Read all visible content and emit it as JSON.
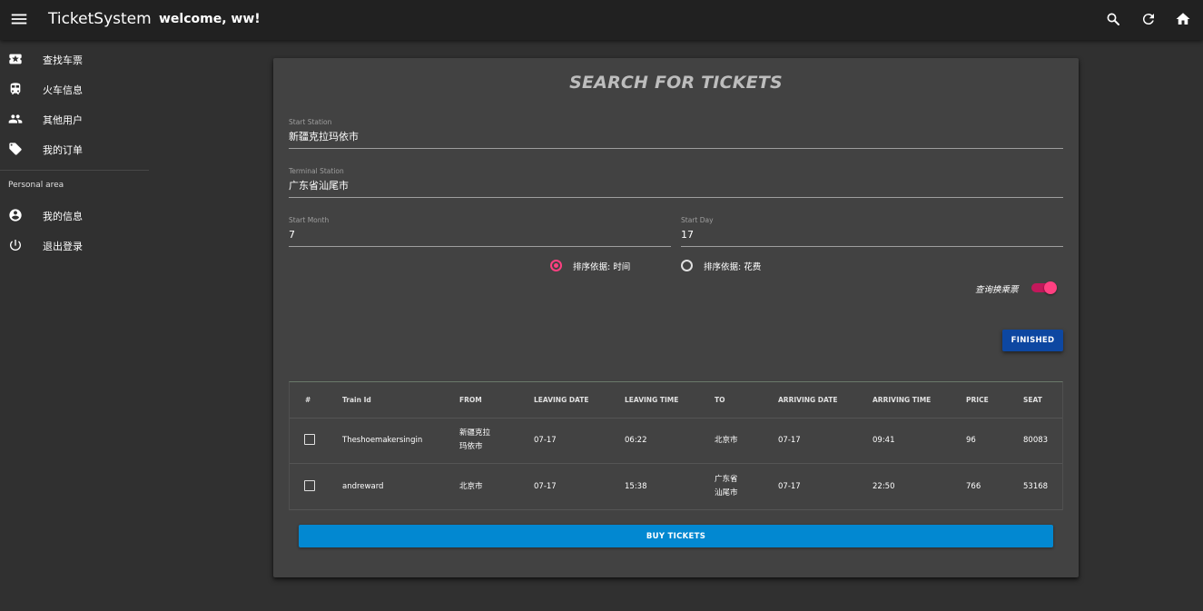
{
  "appbar": {
    "title": "TicketSystem",
    "welcome": "welcome, ww!",
    "tools": [
      "search-icon",
      "refresh-icon",
      "home-icon"
    ]
  },
  "sidebar": {
    "items": [
      {
        "label": "查找车票",
        "icon": "ticket-icon"
      },
      {
        "label": "火车信息",
        "icon": "train-icon"
      },
      {
        "label": "其他用户",
        "icon": "people-icon"
      },
      {
        "label": "我的订单",
        "icon": "tag-icon"
      }
    ],
    "section_label": "Personal area",
    "personal_items": [
      {
        "label": "我的信息",
        "icon": "account-icon"
      },
      {
        "label": "退出登录",
        "icon": "power-icon"
      }
    ]
  },
  "form": {
    "title": "SEARCH FOR TICKETS",
    "start_station": {
      "label": "Start Station",
      "value": "新疆克拉玛依市"
    },
    "terminal_station": {
      "label": "Terminal Station",
      "value": "广东省汕尾市"
    },
    "start_month": {
      "label": "Start Month",
      "value": "7"
    },
    "start_day": {
      "label": "Start Day",
      "value": "17"
    },
    "sort_time": {
      "label": "排序依据: 时间",
      "checked": true
    },
    "sort_cost": {
      "label": "排序依据: 花费",
      "checked": false
    },
    "transfer_switch": {
      "label": "查询换乘票",
      "on": true
    },
    "finished_label": "FINISHED"
  },
  "table": {
    "headers": [
      "#",
      "Train Id",
      "FROM",
      "LEAVING DATE",
      "LEAVING TIME",
      "TO",
      "ARRIVING DATE",
      "ARRIVING TIME",
      "PRICE",
      "SEAT"
    ],
    "rows": [
      {
        "train_id": "Theshoemakersingin",
        "from": [
          "新疆克拉",
          "玛依市"
        ],
        "leaving_date": "07-17",
        "leaving_time": "06:22",
        "to": [
          "北京市"
        ],
        "arriving_date": "07-17",
        "arriving_time": "09:41",
        "price": "96",
        "seat": "80083"
      },
      {
        "train_id": "andreward",
        "from": [
          "北京市"
        ],
        "leaving_date": "07-17",
        "leaving_time": "15:38",
        "to": [
          "广东省",
          "汕尾市"
        ],
        "arriving_date": "07-17",
        "arriving_time": "22:50",
        "price": "766",
        "seat": "53168"
      }
    ]
  },
  "buy_label": "BUY TICKETS",
  "colors": {
    "appbar": "#212121",
    "background": "#303030",
    "card": "#424242",
    "accent": "#ff4081",
    "finished_button": "#0d47a1",
    "buy_button": "#0288d1"
  }
}
